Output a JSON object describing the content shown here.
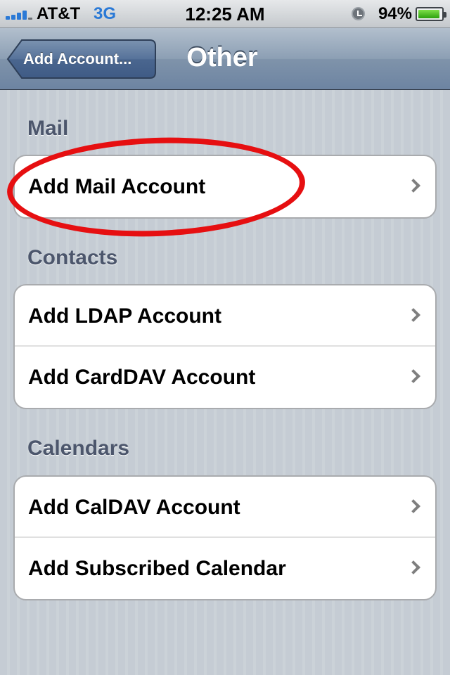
{
  "status_bar": {
    "carrier": "AT&T",
    "network": "3G",
    "time": "12:25 AM",
    "battery_percent": "94%",
    "battery_level": 0.94,
    "signal_bars": 4
  },
  "nav_bar": {
    "back_label": "Add Account...",
    "title": "Other"
  },
  "sections": {
    "mail": {
      "header": "Mail",
      "rows": [
        {
          "label": "Add Mail Account"
        }
      ]
    },
    "contacts": {
      "header": "Contacts",
      "rows": [
        {
          "label": "Add LDAP Account"
        },
        {
          "label": "Add CardDAV Account"
        }
      ]
    },
    "calendars": {
      "header": "Calendars",
      "rows": [
        {
          "label": "Add CalDAV Account"
        },
        {
          "label": "Add Subscribed Calendar"
        }
      ]
    }
  },
  "colors": {
    "annotation": "#e60f11",
    "section_header": "#4c566c",
    "nav_bar": "#6d84a2"
  },
  "icons": [
    "signal-icon",
    "alarm-icon",
    "battery-icon",
    "back-arrow-icon",
    "chevron-right-icon"
  ]
}
